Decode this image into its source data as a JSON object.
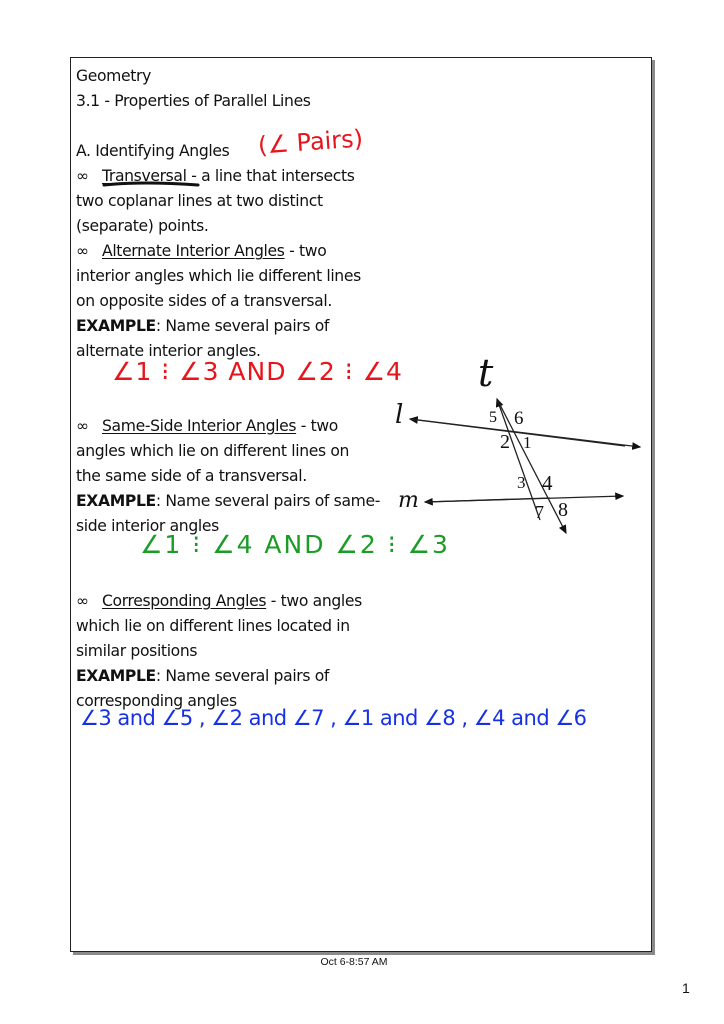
{
  "document": {
    "subject": "Geometry",
    "lesson_title": "3.1 - Properties of Parallel Lines",
    "section_heading": "A.  Identifying Angles",
    "bullet_symbol": "∞",
    "terms": [
      {
        "term": "Transversal",
        "definition_lines": [
          " - a line that intersects",
          "two coplanar lines at two distinct",
          "(separate) points."
        ]
      },
      {
        "term": "Alternate Interior Angles",
        "definition_lines": [
          " - two",
          "interior angles which lie different lines",
          "on opposite sides of a transversal."
        ],
        "example_label": "EXAMPLE",
        "example_lines": [
          ":  Name several pairs of",
          "alternate interior angles."
        ]
      },
      {
        "term": "Same-Side Interior Angles",
        "definition_lines": [
          " - two",
          "angles which lie on different lines on",
          "the same side of a transversal."
        ],
        "example_label": "EXAMPLE",
        "example_lines": [
          ": Name several pairs of same-",
          "side interior angles"
        ]
      },
      {
        "term": "Corresponding Angles",
        "definition_lines": [
          " - two angles",
          "which lie on different lines located in",
          "similar positions"
        ],
        "example_label": "EXAMPLE",
        "example_lines": [
          ": Name several pairs of",
          "corresponding angles"
        ]
      }
    ]
  },
  "handwriting": {
    "angle_pairs_note": "(∠ Pairs)",
    "alternate_interior_answer": "∠1 ⁝ ∠3 AND ∠2 ⁝ ∠4",
    "same_side_interior_answer": "∠1 ⁝ ∠4 AND ∠2 ⁝ ∠3",
    "corresponding_answer": "∠3 and ∠5 ,  ∠2 and ∠7 ,  ∠1 and ∠8 ,  ∠4 and ∠6",
    "colors": {
      "red": "#e8141b",
      "green": "#1a9c26",
      "blue": "#1630e6"
    }
  },
  "diagram": {
    "transversal_label": "t",
    "line_l_label": "l",
    "line_m_label": "m",
    "angle_labels": [
      "1",
      "2",
      "3",
      "4",
      "5",
      "6",
      "7",
      "8"
    ]
  },
  "footer": {
    "timestamp": "Oct 6-8:57 AM",
    "page_number": "1"
  }
}
